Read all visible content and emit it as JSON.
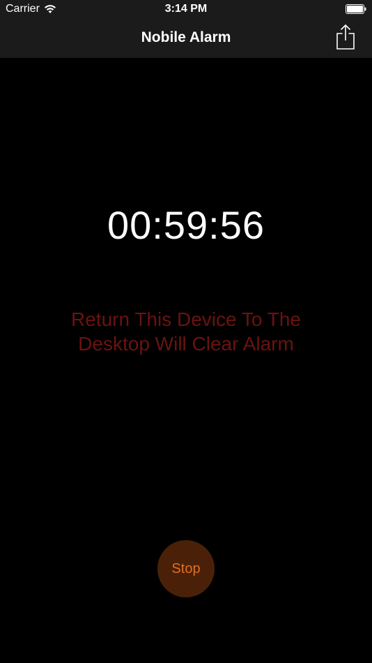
{
  "status_bar": {
    "carrier": "Carrier",
    "time": "3:14 PM",
    "wifi_icon": "wifi-icon",
    "battery_icon": "battery-icon",
    "battery_level": 1.0
  },
  "nav": {
    "title": "Nobile Alarm",
    "share_icon": "share-icon"
  },
  "timer": {
    "value": "00:59:56"
  },
  "notice": {
    "line1": "Return This Device To The",
    "line2": "Desktop Will Clear Alarm"
  },
  "stop_button": {
    "label": "Stop"
  },
  "colors": {
    "background": "#000000",
    "nav_background": "#1b1b1b",
    "notice_text": "#6b130f",
    "stop_background": "#4a2108",
    "stop_text": "#e36d24"
  }
}
